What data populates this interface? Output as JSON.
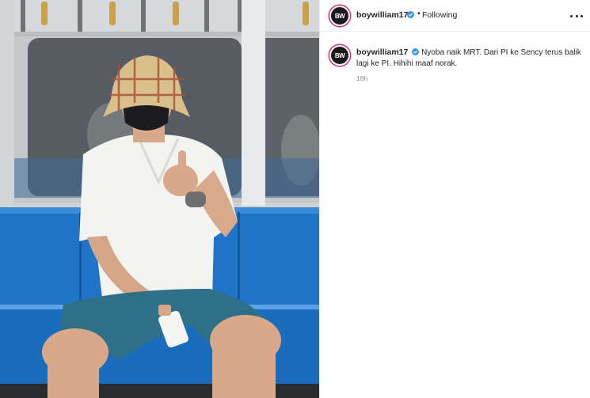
{
  "post": {
    "author": {
      "username": "boywilliam17",
      "avatar_initials": "BW",
      "verified": true
    },
    "follow_status": "Following",
    "separator": "•",
    "caption": "Nyoba naik MRT. Dari PI ke Sency terus balik lagi ke PI. Hihihi maaf norak.",
    "time_ago": "18h"
  },
  "icons": {
    "verified": "verified-badge-icon",
    "more": "more-options-icon"
  },
  "colors": {
    "verified_blue": "#3897f0",
    "seat_blue": "#1e6fc0",
    "story_ring": "#d62976"
  }
}
